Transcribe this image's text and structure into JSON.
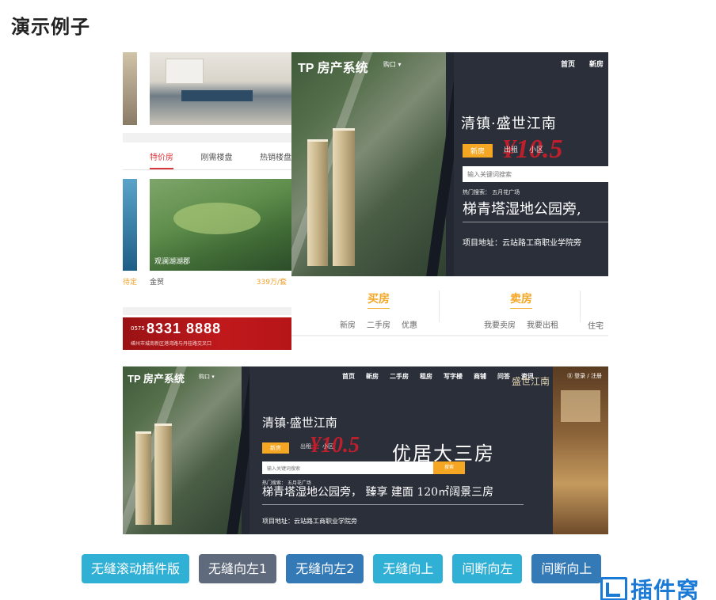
{
  "page": {
    "title": "演示例子"
  },
  "strip": {
    "tabs": [
      "特价房",
      "刚需楼盘",
      "热销楼盘"
    ],
    "photo_caption": "观澜湖湖郡",
    "row": {
      "left": "待定",
      "name": "金贸",
      "price": "339万/套"
    },
    "ad": {
      "code": "0575",
      "phone": "8331 8888",
      "address": "嵊州市城南新区港湾路与丹桂路交叉口"
    }
  },
  "banner1": {
    "logo": "TP 房产系统",
    "city": "购口 ▾",
    "nav": [
      "首页",
      "新房"
    ],
    "project": "清镇·盛世江南",
    "search_tabs": [
      "新房",
      "出租",
      "小区"
    ],
    "promo": "¥10.5",
    "search_placeholder": "输入关键词搜索",
    "hot": "热门搜索： 五月花广场",
    "slogan": "梯青塔湿地公园旁,",
    "address": "项目地址：云站路工商职业学院旁"
  },
  "quicknav": {
    "col1": {
      "title": "买房",
      "items": [
        "新房",
        "二手房",
        "优惠"
      ]
    },
    "col2": {
      "title": "卖房",
      "items": [
        "我要卖房",
        "我要出租"
      ]
    },
    "col3": {
      "item": "住宅"
    }
  },
  "banner2": {
    "logo": "TP 房产系统",
    "city": "购口 ▾",
    "nav": [
      "首页",
      "新房",
      "二手房",
      "租房",
      "写字楼",
      "商铺",
      "问答",
      "资讯"
    ],
    "login": "⓪ 登录 / 注册",
    "brand": "盛世江南",
    "project": "清镇·盛世江南",
    "search_tabs": [
      "新房",
      "出租",
      "出租",
      "小区"
    ],
    "promo": "¥10.5",
    "slogan_big": "优居大三房",
    "search_placeholder": "输入关键词搜索",
    "search_button": "搜索",
    "hot": "热门搜索： 五月花广场",
    "slogan": "梯青塔湿地公园旁， 臻享 建面 120㎡阔景三房",
    "address": "项目地址：云站路工商职业学院旁"
  },
  "buttons": [
    {
      "label": "无缝滚动插件版",
      "style": "info"
    },
    {
      "label": "无缝向左1",
      "style": "default"
    },
    {
      "label": "无缝向左2",
      "style": "primary"
    },
    {
      "label": "无缝向上",
      "style": "info"
    },
    {
      "label": "间断向左",
      "style": "info"
    },
    {
      "label": "间断向上",
      "style": "primary"
    }
  ],
  "watermark": {
    "text": "插件窝",
    "icon": "logo-icon"
  },
  "colors": {
    "accent_orange": "#f5a623",
    "info": "#31b0d5",
    "primary": "#337ab7",
    "default": "#5f6b7d",
    "watermark": "#1a7ad6"
  }
}
